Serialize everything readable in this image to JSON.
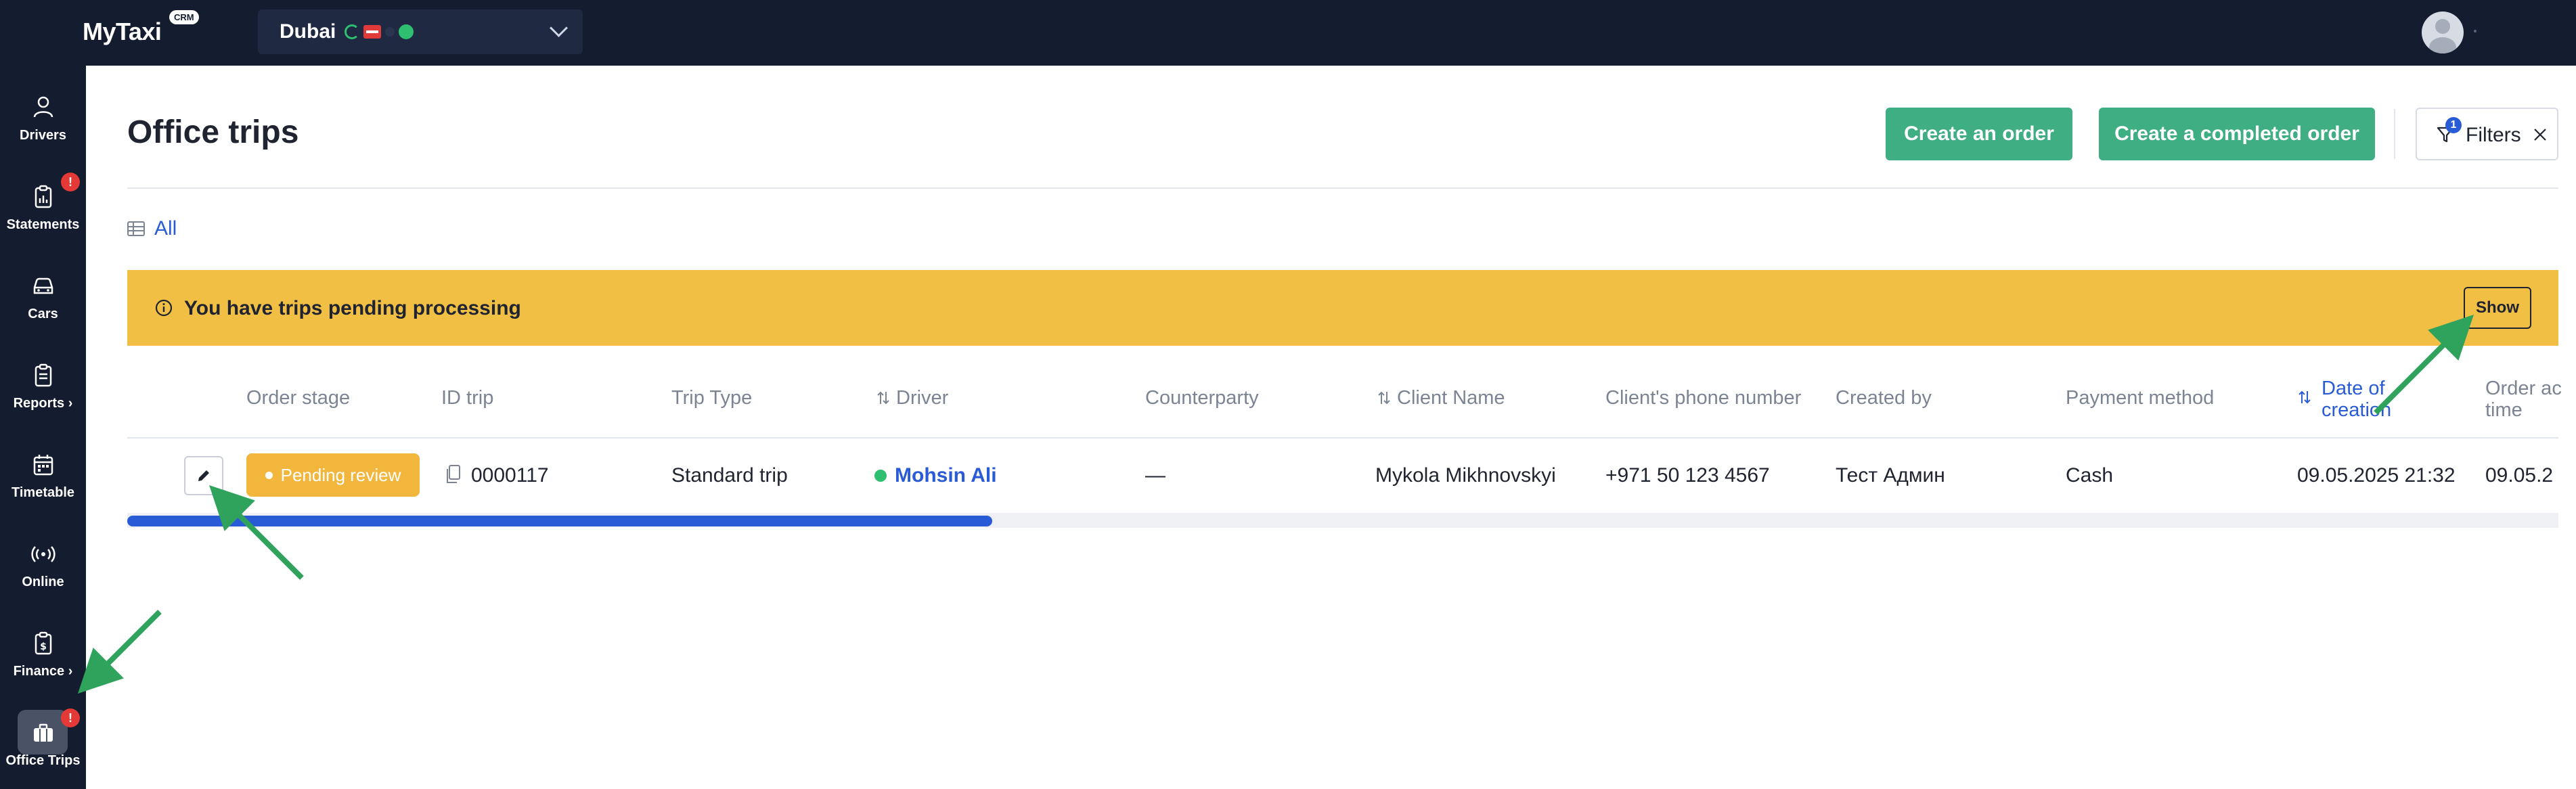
{
  "app": {
    "logo": "MyTaxi",
    "logo_badge": "CRM"
  },
  "city_selector": {
    "value": "Dubai"
  },
  "sidebar": {
    "items": [
      {
        "label": "Drivers",
        "icon": "user-icon",
        "badge": ""
      },
      {
        "label": "Statements",
        "icon": "clipboard-icon",
        "badge": "!"
      },
      {
        "label": "Cars",
        "icon": "car-icon",
        "badge": ""
      },
      {
        "label": "Reports ›",
        "icon": "report-icon",
        "badge": ""
      },
      {
        "label": "Timetable",
        "icon": "calendar-icon",
        "badge": ""
      },
      {
        "label": "Online",
        "icon": "broadcast-icon",
        "badge": ""
      },
      {
        "label": "Finance ›",
        "icon": "finance-icon",
        "badge": ""
      },
      {
        "label": "Office Trips",
        "icon": "briefcase-icon",
        "badge": "!",
        "active": true
      }
    ]
  },
  "header": {
    "title": "Office trips",
    "create_order": "Create an order",
    "create_completed_order": "Create a completed order",
    "filters_label": "Filters",
    "filters_count": "1"
  },
  "view_tab": {
    "label": "All"
  },
  "alert": {
    "text": "You have trips pending processing",
    "button": "Show",
    "color": "#f2bf45"
  },
  "table": {
    "columns": [
      "Order stage",
      "ID trip",
      "Trip Type",
      "Driver",
      "Counterparty",
      "Client Name",
      "Client's phone number",
      "Created by",
      "Payment method",
      "Date of creation",
      "Order ac time"
    ],
    "rows": [
      {
        "stage": "Pending review",
        "id": "0000117",
        "trip_type": "Standard trip",
        "driver": "Mohsin Ali",
        "counterparty": "—",
        "client_name": "Mykola Mikhnovskyi",
        "phone": "+971 50 123 4567",
        "created_by": "Тест Админ",
        "payment": "Cash",
        "date_created": "09.05.2025 21:32",
        "order_time": "09.05.2"
      }
    ]
  },
  "colors": {
    "accent": "#3fae83",
    "link": "#2a5bd7",
    "nav_bg": "#141c2f",
    "warning": "#f2b63d",
    "arrow": "#2fa35c"
  }
}
